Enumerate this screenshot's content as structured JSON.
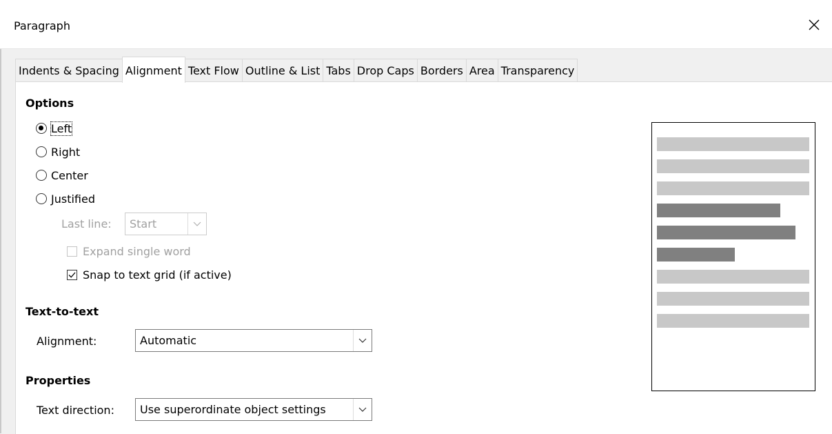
{
  "window": {
    "title": "Paragraph"
  },
  "tabs": [
    {
      "label": "Indents & Spacing",
      "active": false
    },
    {
      "label": "Alignment",
      "active": true
    },
    {
      "label": "Text Flow",
      "active": false
    },
    {
      "label": "Outline & List",
      "active": false
    },
    {
      "label": "Tabs",
      "active": false
    },
    {
      "label": "Drop Caps",
      "active": false
    },
    {
      "label": "Borders",
      "active": false
    },
    {
      "label": "Area",
      "active": false
    },
    {
      "label": "Transparency",
      "active": false
    }
  ],
  "options": {
    "heading": "Options",
    "radios": [
      {
        "label": "Left",
        "checked": true
      },
      {
        "label": "Right",
        "checked": false
      },
      {
        "label": "Center",
        "checked": false
      },
      {
        "label": "Justified",
        "checked": false
      }
    ],
    "last_line_label": "Last line:",
    "last_line_value": "Start",
    "expand_single_word": {
      "label": "Expand single word",
      "checked": false,
      "enabled": false
    },
    "snap_to_grid": {
      "label": "Snap to text grid (if active)",
      "checked": true,
      "enabled": true
    }
  },
  "text_to_text": {
    "heading": "Text-to-text",
    "alignment_label": "Alignment:",
    "alignment_value": "Automatic"
  },
  "properties": {
    "heading": "Properties",
    "direction_label": "Text direction:",
    "direction_value": "Use superordinate object settings"
  },
  "preview": {
    "colors": {
      "context": "#c8c8c8",
      "current": "#808080"
    },
    "lines": [
      {
        "kind": "context",
        "length": 1.0
      },
      {
        "kind": "context",
        "length": 1.0
      },
      {
        "kind": "context",
        "length": 1.0
      },
      {
        "kind": "current",
        "length": 0.81
      },
      {
        "kind": "current",
        "length": 0.91
      },
      {
        "kind": "current",
        "length": 0.51
      },
      {
        "kind": "context",
        "length": 1.0
      },
      {
        "kind": "context",
        "length": 1.0
      },
      {
        "kind": "context",
        "length": 1.0
      }
    ]
  }
}
